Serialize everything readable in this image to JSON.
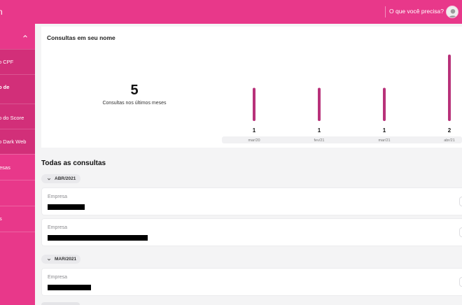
{
  "header": {
    "brand_fragment": "n",
    "help_label": "O que você precisa?",
    "icons": {
      "help_chevron": "chevron-down-icon",
      "avatar": "user-avatar-icon"
    }
  },
  "sidebar": {
    "collapse_icon": "chevron-up-icon",
    "sub_items": [
      {
        "label": "o CPF"
      },
      {
        "label": "o de"
      },
      {
        "label": "o do Score"
      },
      {
        "label": "o Dark Web"
      }
    ],
    "items": [
      {
        "label": "esas"
      },
      {
        "label": ""
      },
      {
        "label": "s"
      },
      {
        "label": ""
      }
    ]
  },
  "summary": {
    "title": "Consultas em seu nome",
    "total": "5",
    "caption": "Consultas nos últimos meses"
  },
  "chart_data": {
    "type": "bar",
    "categories": [
      "mar/20",
      "fev/21",
      "mar/21",
      "abr/21"
    ],
    "values": [
      1,
      1,
      1,
      2
    ],
    "value_labels": [
      "1",
      "1",
      "1",
      "2"
    ],
    "bar_color": "#b8327a",
    "ylim": [
      0,
      2
    ]
  },
  "all_queries": {
    "title": "Todas as consultas",
    "groups": [
      {
        "month": "ABR/2021",
        "entries": [
          {
            "label": "Empresa",
            "value": ""
          },
          {
            "label": "Empresa",
            "value": ""
          }
        ]
      },
      {
        "month": "MAR/2021",
        "entries": [
          {
            "label": "Empresa",
            "value": ""
          }
        ]
      }
    ]
  },
  "colors": {
    "brand_pink": "#e8388a",
    "sidebar_active": "#d22f79",
    "bar": "#b8327a"
  }
}
